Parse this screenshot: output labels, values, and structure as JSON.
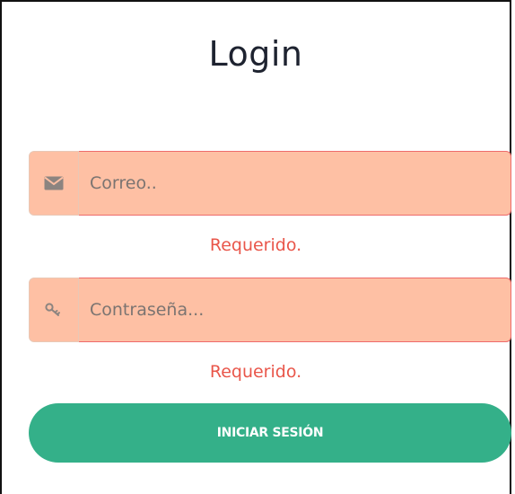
{
  "form": {
    "title": "Login",
    "email": {
      "placeholder": "Correo..",
      "value": "",
      "error": "Requerido.",
      "icon": "envelope-icon"
    },
    "password": {
      "placeholder": "Contraseña...",
      "value": "",
      "error": "Requerido.",
      "icon": "key-icon"
    },
    "submit_label": "INICIAR SESIÓN"
  },
  "colors": {
    "field_background": "#fec0a4",
    "field_border_error": "#ee6b6b",
    "error_text": "#e9564a",
    "button": "#34b089",
    "button_text": "#ffffff",
    "title_text": "#1e2330"
  }
}
